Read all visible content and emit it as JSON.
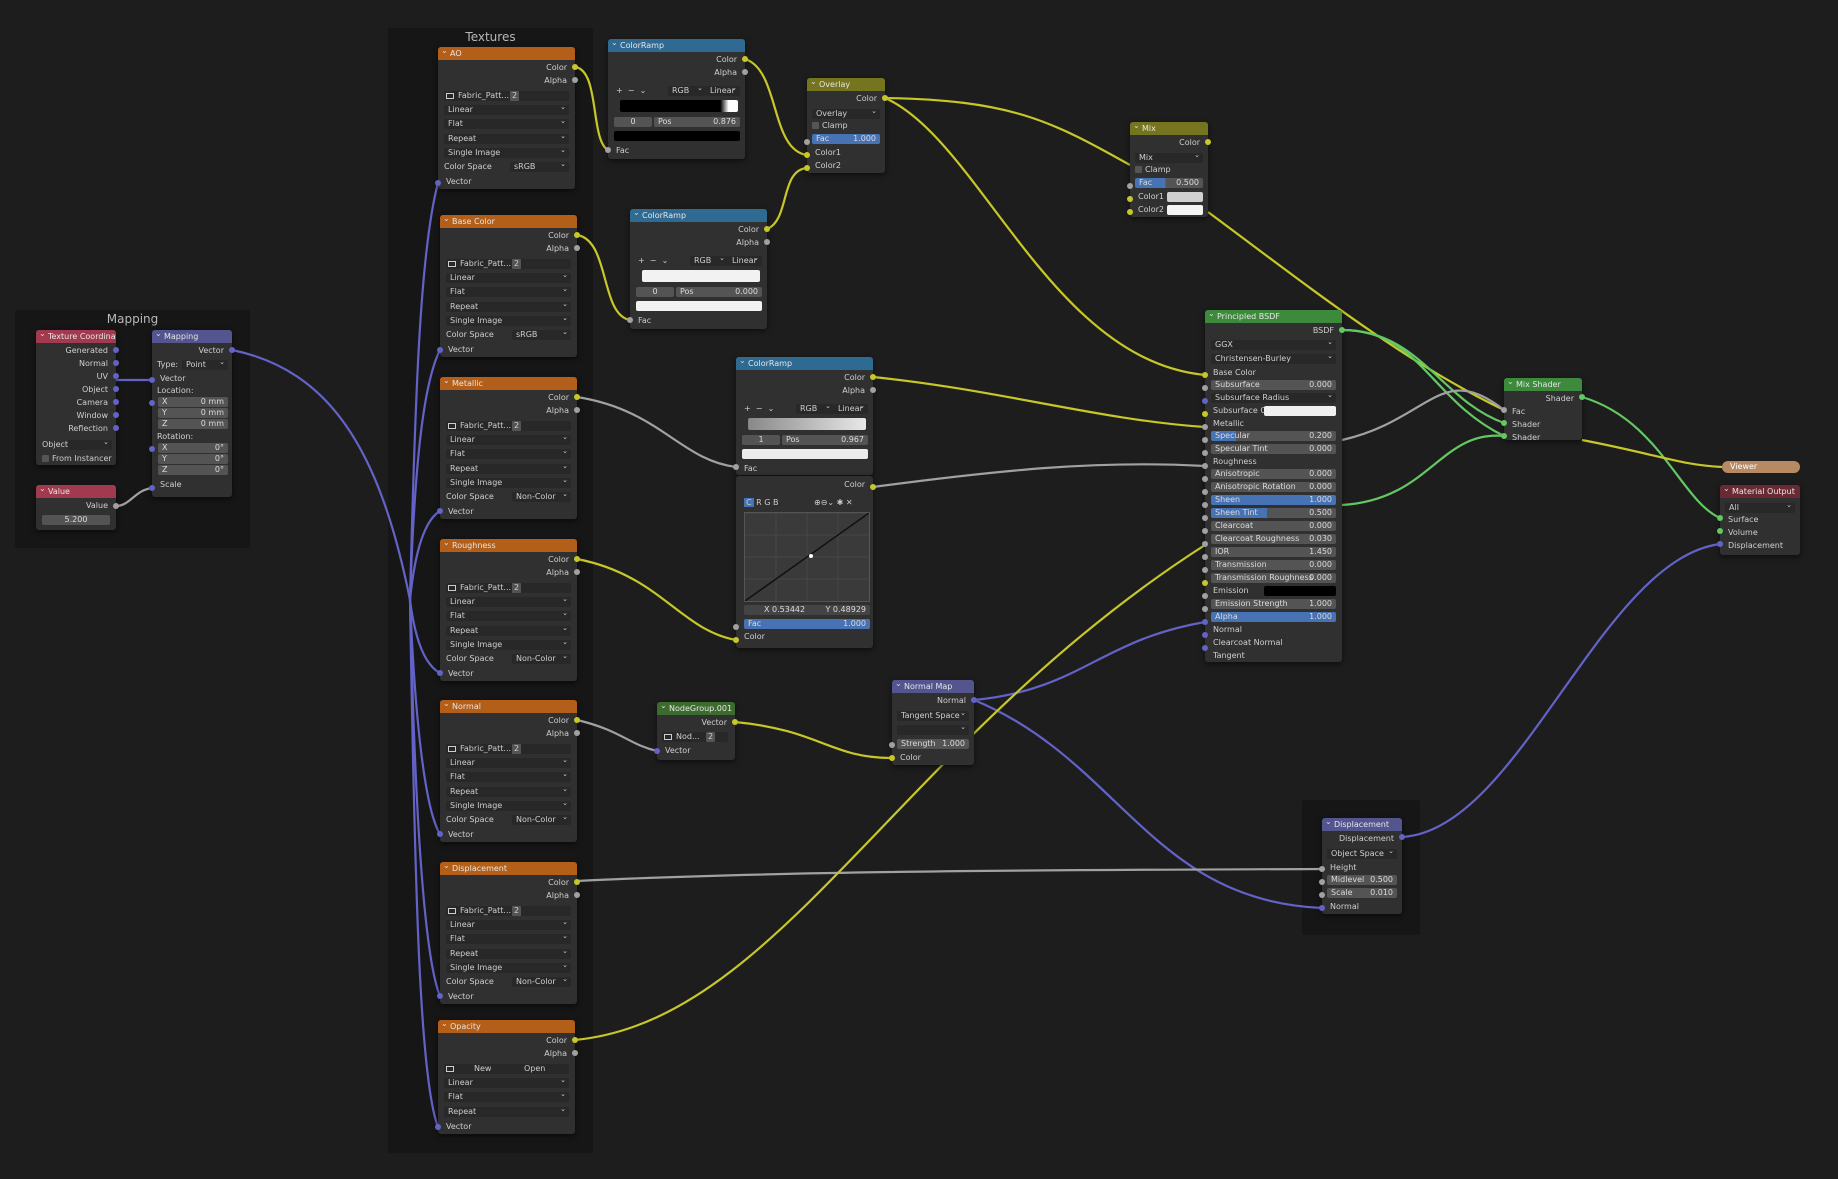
{
  "frames": {
    "mapping_label": "Mapping",
    "textures_label": "Textures"
  },
  "texture_coordinate": {
    "title": "Texture Coordinate",
    "outputs": [
      "Generated",
      "Normal",
      "UV",
      "Object",
      "Camera",
      "Window",
      "Reflection"
    ],
    "object_label": "Object",
    "from_instancer": "From Instancer"
  },
  "value_node": {
    "title": "Value",
    "out": "Value",
    "value": "5.200"
  },
  "mapping_node": {
    "title": "Mapping",
    "out": "Vector",
    "type_label": "Type:",
    "type_value": "Point",
    "vector_in": "Vector",
    "location": "Location:",
    "loc": [
      "X",
      "Y",
      "Z"
    ],
    "loc_vals": [
      "0 mm",
      "0 mm",
      "0 mm"
    ],
    "rotation": "Rotation:",
    "rot": [
      "X",
      "Y",
      "Z"
    ],
    "rot_vals": [
      "0°",
      "0°",
      "0°"
    ],
    "scale": "Scale"
  },
  "image_common": {
    "file": "Fabric_Patt...",
    "users": "2",
    "interp": "Linear",
    "proj": "Flat",
    "ext": "Repeat",
    "source": "Single Image",
    "cs_label": "Color Space",
    "color_out": "Color",
    "alpha_out": "Alpha",
    "vector_in": "Vector"
  },
  "tex_nodes": [
    {
      "title": "AO",
      "cs": "sRGB"
    },
    {
      "title": "Base Color",
      "cs": "sRGB"
    },
    {
      "title": "Metallic",
      "cs": "Non-Color"
    },
    {
      "title": "Roughness",
      "cs": "Non-Color"
    },
    {
      "title": "Normal",
      "cs": "Non-Color"
    },
    {
      "title": "Displacement",
      "cs": "Non-Color"
    }
  ],
  "opacity_node": {
    "title": "Opacity",
    "new": "New",
    "open": "Open"
  },
  "colorramps": [
    {
      "title": "ColorRamp",
      "color": "Color",
      "alpha": "Alpha",
      "mode": "RGB",
      "interp": "Linear",
      "idx": "0",
      "pos_label": "Pos",
      "pos": "0.876",
      "fac": "Fac"
    },
    {
      "title": "ColorRamp",
      "color": "Color",
      "alpha": "Alpha",
      "mode": "RGB",
      "interp": "Linear",
      "idx": "0",
      "pos_label": "Pos",
      "pos": "0.000",
      "fac": "Fac"
    },
    {
      "title": "ColorRamp",
      "color": "Color",
      "alpha": "Alpha",
      "mode": "RGB",
      "interp": "Linear",
      "idx": "1",
      "pos_label": "Pos",
      "pos": "0.967",
      "fac": "Fac"
    }
  ],
  "rgbcurves": {
    "color_out": "Color",
    "channels": [
      "C",
      "R",
      "G",
      "B"
    ],
    "x": "X 0.53442",
    "y": "Y 0.48929",
    "fac_label": "Fac",
    "fac": "1.000",
    "color_in": "Color"
  },
  "overlay_node": {
    "title": "Overlay",
    "out": "Color",
    "mode": "Overlay",
    "clamp": "Clamp",
    "fac_label": "Fac",
    "fac": "1.000",
    "c1": "Color1",
    "c2": "Color2"
  },
  "mix_node": {
    "title": "Mix",
    "out": "Color",
    "mode": "Mix",
    "clamp": "Clamp",
    "fac_label": "Fac",
    "fac": "0.500",
    "c1": "Color1",
    "c2": "Color2"
  },
  "principled": {
    "title": "Principled BSDF",
    "out": "BSDF",
    "dist": "GGX",
    "sss": "Christensen-Burley",
    "base_color": "Base Color",
    "subsurface": "Subsurface",
    "subsurface_v": "0.000",
    "subsurface_radius": "Subsurface Radius",
    "subsurface_color": "Subsurface C...",
    "metallic": "Metallic",
    "specular": "Specular",
    "specular_v": "0.200",
    "specular_tint": "Specular Tint",
    "specular_tint_v": "0.000",
    "roughness": "Roughness",
    "anisotropic": "Anisotropic",
    "anisotropic_v": "0.000",
    "aniso_rot": "Anisotropic Rotation",
    "aniso_rot_v": "0.000",
    "sheen": "Sheen",
    "sheen_v": "1.000",
    "sheen_tint": "Sheen Tint",
    "sheen_tint_v": "0.500",
    "clearcoat": "Clearcoat",
    "clearcoat_v": "0.000",
    "clearcoat_r": "Clearcoat Roughness",
    "clearcoat_r_v": "0.030",
    "ior": "IOR",
    "ior_v": "1.450",
    "transmission": "Transmission",
    "transmission_v": "0.000",
    "trans_r": "Transmission Roughness",
    "trans_r_v": "0.000",
    "emission": "Emission",
    "em_strength": "Emission Strength",
    "em_strength_v": "1.000",
    "alpha": "Alpha",
    "alpha_v": "1.000",
    "normal": "Normal",
    "clearcoat_normal": "Clearcoat Normal",
    "tangent": "Tangent"
  },
  "mix_shader": {
    "title": "Mix Shader",
    "out": "Shader",
    "fac": "Fac",
    "s1": "Shader",
    "s2": "Shader"
  },
  "viewer": {
    "title": "Viewer"
  },
  "material_output": {
    "title": "Material Output",
    "target": "All",
    "surface": "Surface",
    "volume": "Volume",
    "displacement": "Displacement"
  },
  "normal_map": {
    "title": "Normal Map",
    "out": "Normal",
    "space": "Tangent Space",
    "strength_label": "Strength",
    "strength": "1.000",
    "color_in": "Color"
  },
  "nodegroup": {
    "title": "NodeGroup.001",
    "out": "Vector",
    "name": "Nod...",
    "users": "2",
    "in": "Vector"
  },
  "displacement_node": {
    "title": "Displacement",
    "out": "Displacement",
    "space": "Object Space",
    "height": "Height",
    "midlevel_label": "Midlevel",
    "midlevel": "0.500",
    "scale_label": "Scale",
    "scale": "0.010",
    "normal": "Normal"
  },
  "colors": {
    "yellow": "#c7c729",
    "grey": "#a1a1a1",
    "blue": "#6363c7",
    "green": "#63c763"
  }
}
